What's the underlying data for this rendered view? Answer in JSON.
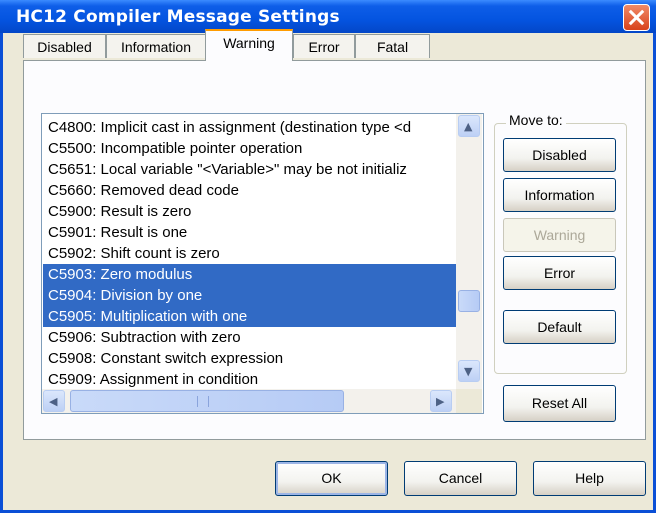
{
  "window": {
    "title": "HC12 Compiler Message Settings"
  },
  "tabs": [
    {
      "label": "Disabled",
      "active": false
    },
    {
      "label": "Information",
      "active": false
    },
    {
      "label": "Warning",
      "active": true
    },
    {
      "label": "Error",
      "active": false
    },
    {
      "label": "Fatal",
      "active": false
    }
  ],
  "messages": [
    {
      "text": "C4800: Implicit cast in assignment (destination type <d",
      "selected": false
    },
    {
      "text": "C5500: Incompatible pointer operation",
      "selected": false
    },
    {
      "text": "C5651: Local variable \"<Variable>\" may be not initializ",
      "selected": false
    },
    {
      "text": "C5660: Removed dead code",
      "selected": false
    },
    {
      "text": "C5900: Result is zero",
      "selected": false
    },
    {
      "text": "C5901: Result is one",
      "selected": false
    },
    {
      "text": "C5902: Shift count is zero",
      "selected": false
    },
    {
      "text": "C5903: Zero modulus",
      "selected": true
    },
    {
      "text": "C5904: Division by one",
      "selected": true
    },
    {
      "text": "C5905: Multiplication with one",
      "selected": true
    },
    {
      "text": "C5906: Subtraction with zero",
      "selected": false
    },
    {
      "text": "C5908: Constant switch expression",
      "selected": false
    },
    {
      "text": "C5909: Assignment in condition",
      "selected": false
    }
  ],
  "move_to": {
    "label": "Move to:",
    "disabled": "Disabled",
    "information": "Information",
    "warning": "Warning",
    "error": "Error",
    "default": "Default"
  },
  "reset_all": "Reset All",
  "footer": {
    "ok": "OK",
    "cancel": "Cancel",
    "help": "Help"
  },
  "icons": {
    "close": "close-icon",
    "scroll_up": "triangle-up",
    "scroll_down": "triangle-down",
    "scroll_left": "triangle-left",
    "scroll_right": "triangle-right"
  },
  "colors": {
    "title_bar": "#0454e0",
    "selection": "#316ac5",
    "tab_highlight": "#ff9c00",
    "close_button": "#d8421b"
  }
}
